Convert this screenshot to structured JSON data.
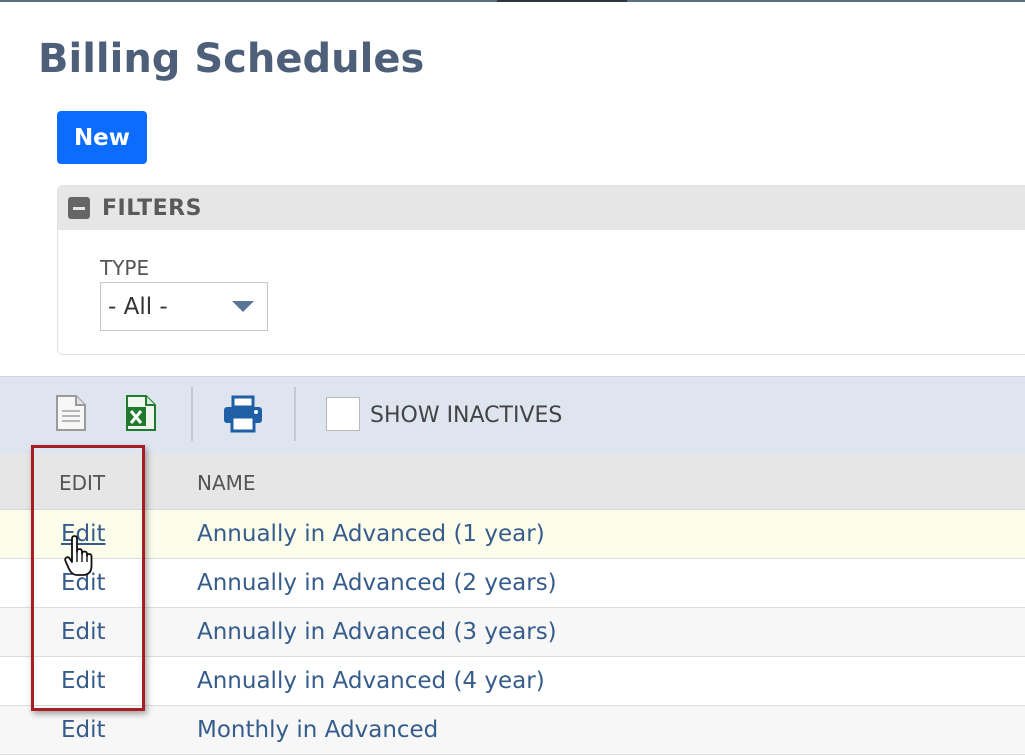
{
  "page": {
    "title": "Billing Schedules"
  },
  "actions": {
    "new_label": "New"
  },
  "filters": {
    "header": "FILTERS",
    "type_label": "TYPE",
    "type_value": "- All -"
  },
  "toolbar": {
    "icons": [
      "document-icon",
      "excel-export-icon",
      "print-icon"
    ],
    "show_inactives_label": "SHOW INACTIVES",
    "show_inactives_checked": false
  },
  "table": {
    "columns": [
      "EDIT",
      "NAME"
    ],
    "rows": [
      {
        "edit": "Edit",
        "name": "Annually in Advanced (1 year)"
      },
      {
        "edit": "Edit",
        "name": "Annually in Advanced (2 years)"
      },
      {
        "edit": "Edit",
        "name": "Annually in Advanced (3 years)"
      },
      {
        "edit": "Edit",
        "name": "Annually in Advanced (4 year)"
      },
      {
        "edit": "Edit",
        "name": "Monthly in Advanced"
      }
    ]
  },
  "colors": {
    "primary_button": "#0b6cff",
    "title": "#4d5f79",
    "link": "#365c8c",
    "highlight_box": "#a41e23"
  }
}
